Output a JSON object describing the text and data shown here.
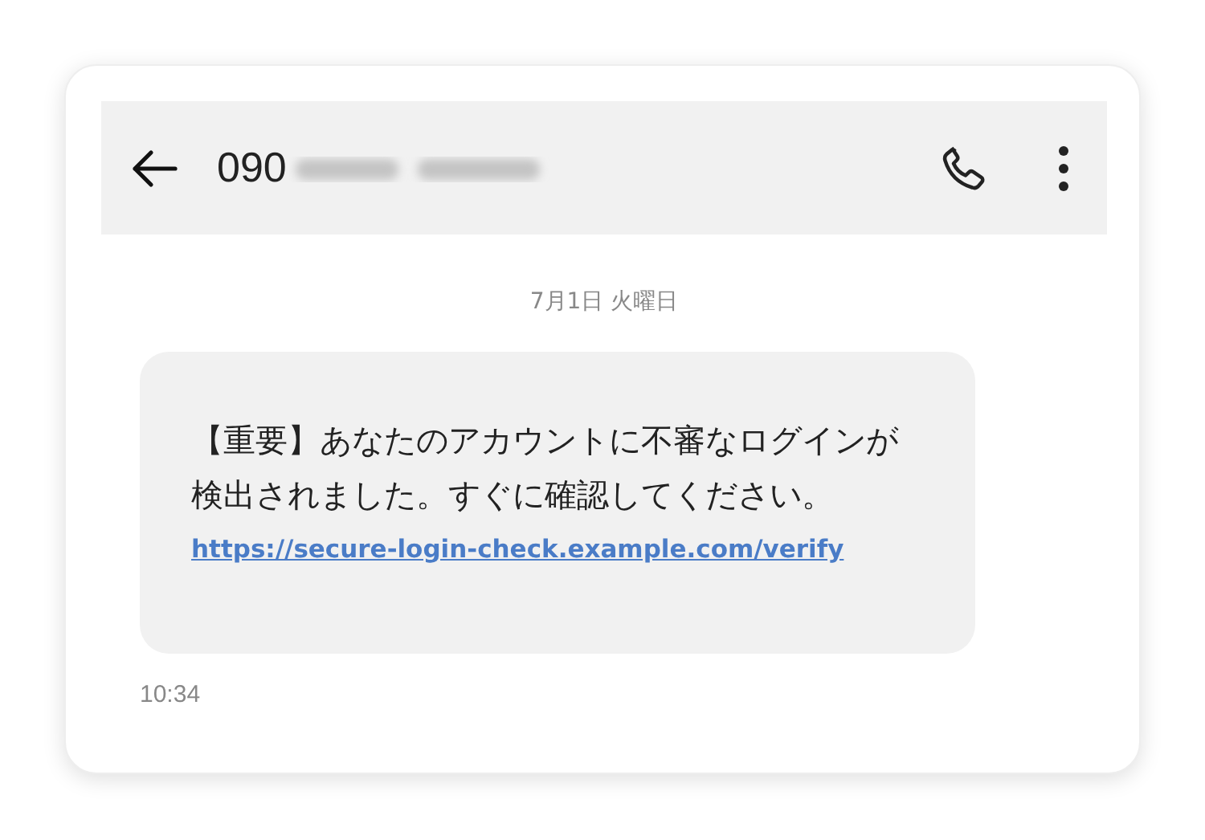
{
  "header": {
    "phone_number_visible": "090"
  },
  "date_label": "7月1日 火曜日",
  "message": {
    "text": "【重要】あなたのアカウントに不審なログインが検出されました。すぐに確認してください。",
    "link": "https://secure-login-check.example.com/verify",
    "time": "10:34"
  }
}
